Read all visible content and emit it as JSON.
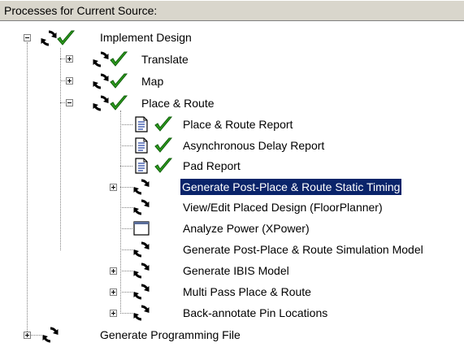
{
  "panel": {
    "title": "Processes for Current Source:"
  },
  "tree": {
    "implement_design": "Implement Design",
    "translate": "Translate",
    "map": "Map",
    "place_route": "Place & Route",
    "place_route_report": "Place & Route Report",
    "async_delay_report": "Asynchronous Delay Report",
    "pad_report": "Pad Report",
    "gen_static_timing": "Generate Post-Place & Route Static Timing",
    "view_edit_placed": "View/Edit Placed Design (FloorPlanner)",
    "analyze_power": "Analyze Power (XPower)",
    "gen_sim_model": "Generate Post-Place & Route Simulation Model",
    "gen_ibis": "Generate IBIS Model",
    "multi_pass": "Multi Pass Place & Route",
    "back_annotate": "Back-annotate Pin Locations",
    "gen_programming": "Generate Programming File"
  },
  "colors": {
    "selection": "#0a246a",
    "check": "#2e9d1e",
    "header_bg": "#d9d6cc"
  },
  "icons": {
    "process": "refresh-icon",
    "done": "checkmark-icon",
    "report": "report-document-icon",
    "tool": "window-icon"
  }
}
